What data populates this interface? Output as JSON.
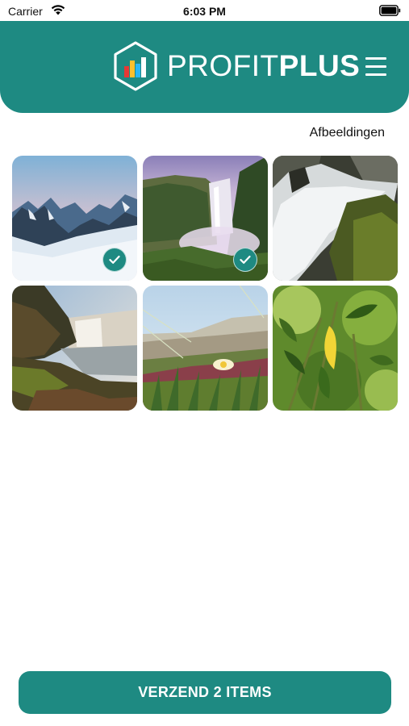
{
  "status_bar": {
    "carrier": "Carrier",
    "time": "6:03 PM"
  },
  "header": {
    "logo_text_light": "PROFIT",
    "logo_text_bold": "PLUS",
    "menu_icon": "hamburger-menu-icon",
    "background_color": "#1e8a82"
  },
  "section_title": "Afbeeldingen",
  "gallery": {
    "images": [
      {
        "subject": "snowy mountain range at dusk",
        "selected": true
      },
      {
        "subject": "waterfall in misty valley",
        "selected": true
      },
      {
        "subject": "long-exposure waterfall over mossy rocks",
        "selected": false
      },
      {
        "subject": "waterfall with rocky shore",
        "selected": false
      },
      {
        "subject": "flower on coastal dune",
        "selected": false
      },
      {
        "subject": "green leaves with yellow leaf",
        "selected": false
      }
    ]
  },
  "send_button_label": "VERZEND 2 ITEMS",
  "accent_color": "#1e8a82"
}
